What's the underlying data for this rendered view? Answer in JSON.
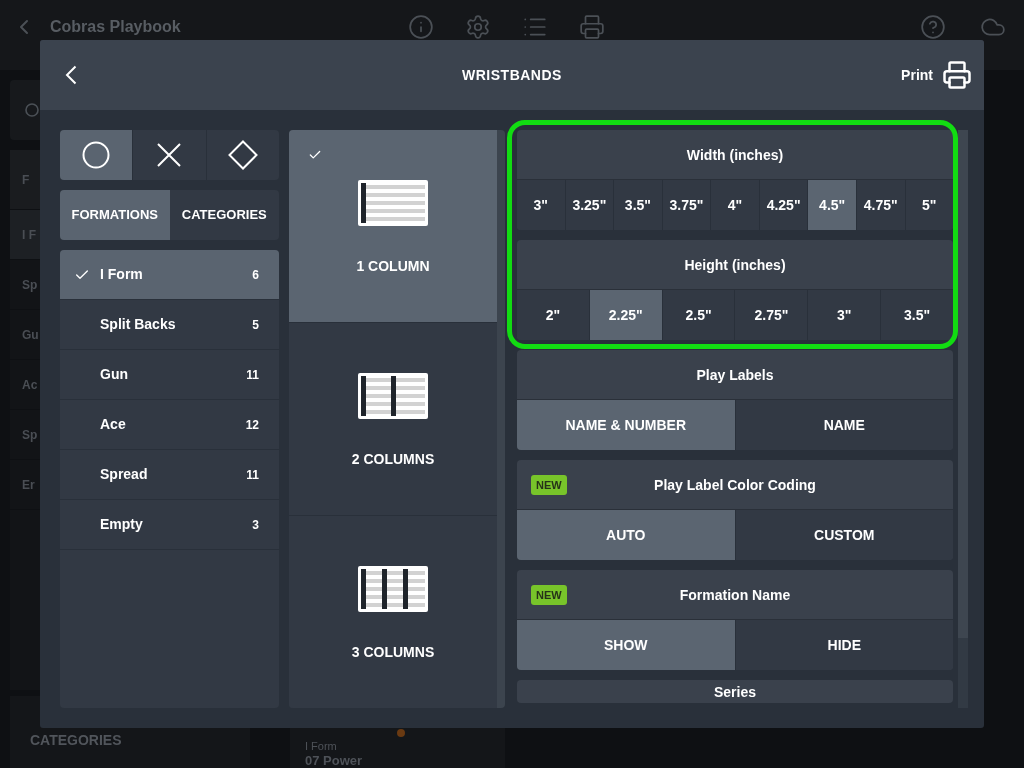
{
  "background": {
    "title": "Cobras Playbook",
    "sidebar": {
      "header": "F",
      "items": [
        {
          "label": "I F",
          "selected": true
        },
        {
          "label": "Sp",
          "selected": false
        },
        {
          "label": "Gu",
          "selected": false
        },
        {
          "label": "Ac",
          "selected": false
        },
        {
          "label": "Sp",
          "selected": false
        },
        {
          "label": "Er",
          "selected": false
        }
      ]
    },
    "categories_tab": "CATEGORIES",
    "play_card": {
      "formation": "I Form",
      "name": "07 Power"
    }
  },
  "dialog": {
    "title": "WRISTBANDS",
    "print_button": "Print",
    "shape_filters": [
      {
        "kind": "circle",
        "selected": true
      },
      {
        "kind": "cross",
        "selected": false
      },
      {
        "kind": "diamond",
        "selected": false
      }
    ],
    "tabs": [
      {
        "label": "FORMATIONS",
        "selected": true
      },
      {
        "label": "CATEGORIES",
        "selected": false
      }
    ],
    "formations": [
      {
        "name": "I Form",
        "count": "6",
        "selected": true
      },
      {
        "name": "Split Backs",
        "count": "5",
        "selected": false
      },
      {
        "name": "Gun",
        "count": "11",
        "selected": false
      },
      {
        "name": "Ace",
        "count": "12",
        "selected": false
      },
      {
        "name": "Spread",
        "count": "11",
        "selected": false
      },
      {
        "name": "Empty",
        "count": "3",
        "selected": false
      }
    ],
    "layouts": [
      {
        "kind": "single",
        "label": "1 COLUMN",
        "selected": true
      },
      {
        "kind": "double",
        "label": "2 COLUMNS",
        "selected": false
      },
      {
        "kind": "triple",
        "label": "3 COLUMNS",
        "selected": false
      }
    ],
    "settings": [
      {
        "title": "Width (inches)",
        "highlighted": true,
        "options": [
          {
            "label": "3\"",
            "selected": false
          },
          {
            "label": "3.25\"",
            "selected": false
          },
          {
            "label": "3.5\"",
            "selected": false
          },
          {
            "label": "3.75\"",
            "selected": false
          },
          {
            "label": "4\"",
            "selected": false
          },
          {
            "label": "4.25\"",
            "selected": false
          },
          {
            "label": "4.5\"",
            "selected": true
          },
          {
            "label": "4.75\"",
            "selected": false
          },
          {
            "label": "5\"",
            "selected": false
          }
        ]
      },
      {
        "title": "Height (inches)",
        "highlighted": true,
        "options": [
          {
            "label": "2\"",
            "selected": false
          },
          {
            "label": "2.25\"",
            "selected": true
          },
          {
            "label": "2.5\"",
            "selected": false
          },
          {
            "label": "2.75\"",
            "selected": false
          },
          {
            "label": "3\"",
            "selected": false
          },
          {
            "label": "3.5\"",
            "selected": false
          }
        ]
      },
      {
        "title": "Play Labels",
        "highlighted": false,
        "options": [
          {
            "label": "NAME & NUMBER",
            "selected": true
          },
          {
            "label": "NAME",
            "selected": false
          }
        ]
      },
      {
        "title": "Play Label Color Coding",
        "badge": "NEW",
        "highlighted": false,
        "options": [
          {
            "label": "AUTO",
            "selected": true
          },
          {
            "label": "CUSTOM",
            "selected": false
          }
        ]
      },
      {
        "title": "Formation Name",
        "badge": "NEW",
        "highlighted": false,
        "options": [
          {
            "label": "SHOW",
            "selected": true
          },
          {
            "label": "HIDE",
            "selected": false
          }
        ]
      },
      {
        "title": "Series",
        "highlighted": false
      }
    ]
  }
}
